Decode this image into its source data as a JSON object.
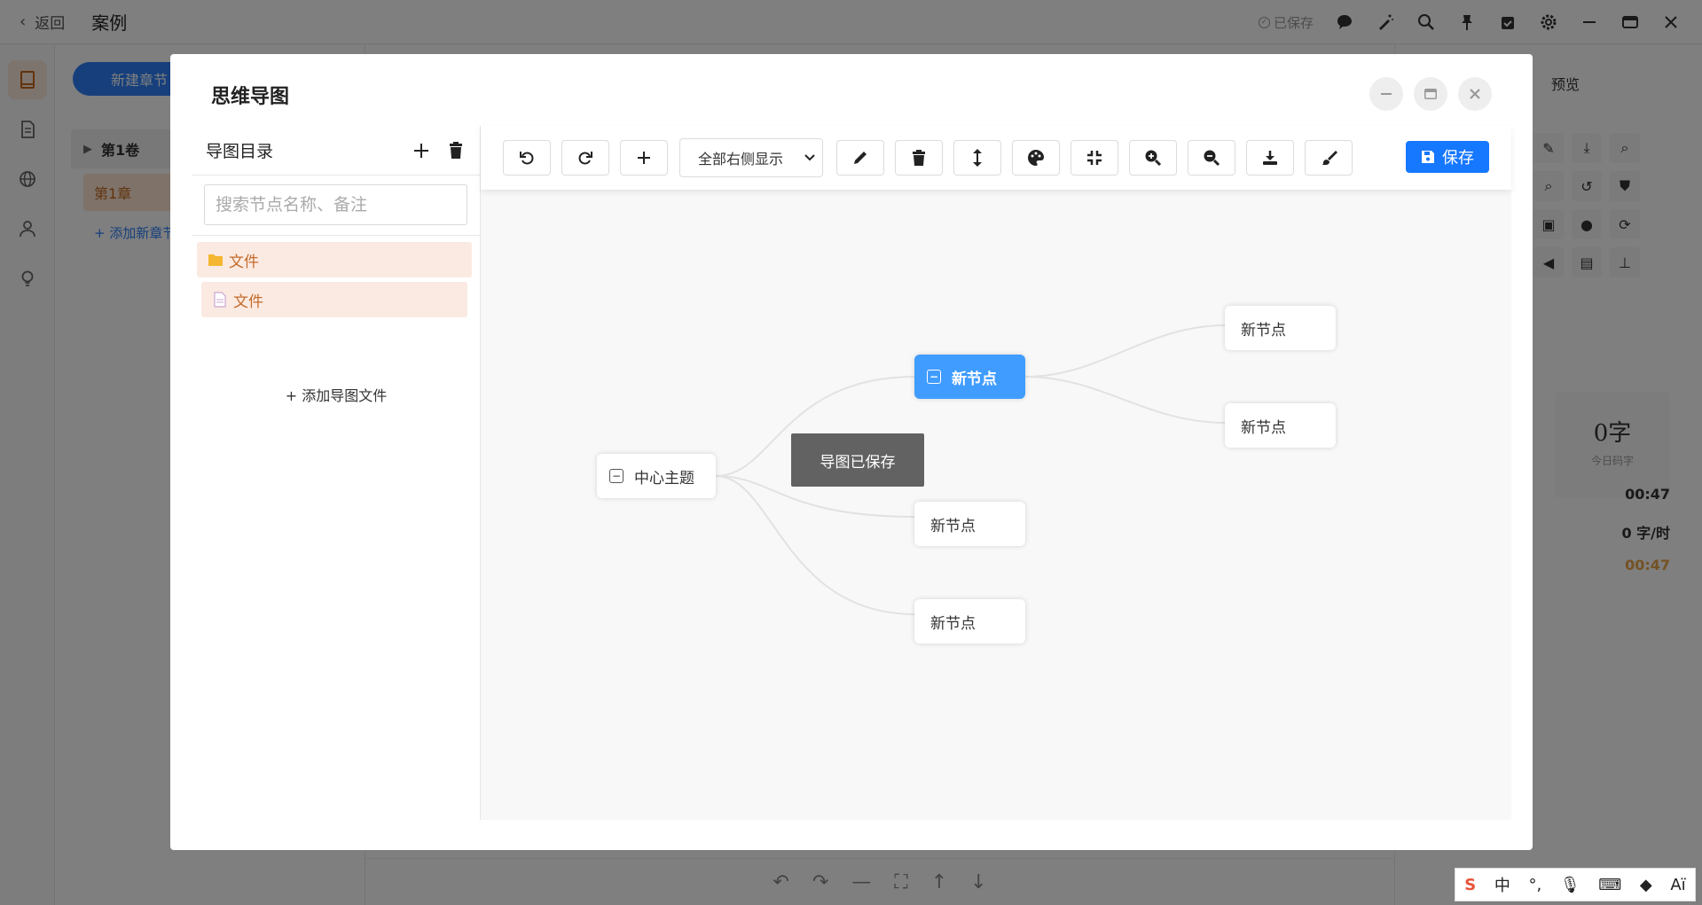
{
  "app": {
    "back_label": "返回",
    "case_title": "案例",
    "saved_status": "已保存"
  },
  "chapters": {
    "new_chapter_label": "新建章节",
    "volume_label": "第1卷",
    "chapter_label": "第1章",
    "add_chapter_label": "+ 添加新章节"
  },
  "right_panel": {
    "preview_label": "预览",
    "today_words_value": "0字",
    "today_words_label": "今日码字",
    "time_value": "00:47",
    "speed_value": "0 字/时",
    "timer_value": "00:47"
  },
  "dialog": {
    "title": "思维导图",
    "tree": {
      "header": "导图目录",
      "search_placeholder": "搜索节点名称、备注",
      "folder_label": "文件",
      "file_label": "文件",
      "add_file_label": "+ 添加导图文件"
    },
    "toolbar": {
      "layout_option": "全部右侧显示",
      "save_label": "保存"
    },
    "mindmap": {
      "root": "中心主题",
      "child_1": "新节点",
      "child_2": "新节点",
      "child_3": "新节点",
      "grandchild_1": "新节点",
      "grandchild_2": "新节点"
    },
    "toast": "导图已保存"
  },
  "ime": {
    "mode": "中"
  },
  "colors": {
    "primary": "#1677ff",
    "active_node": "#409cff",
    "tree_item_bg": "#fbeae2",
    "tree_item_text": "#c46a2a",
    "overlay": "rgba(0,0,0,0.5)"
  }
}
